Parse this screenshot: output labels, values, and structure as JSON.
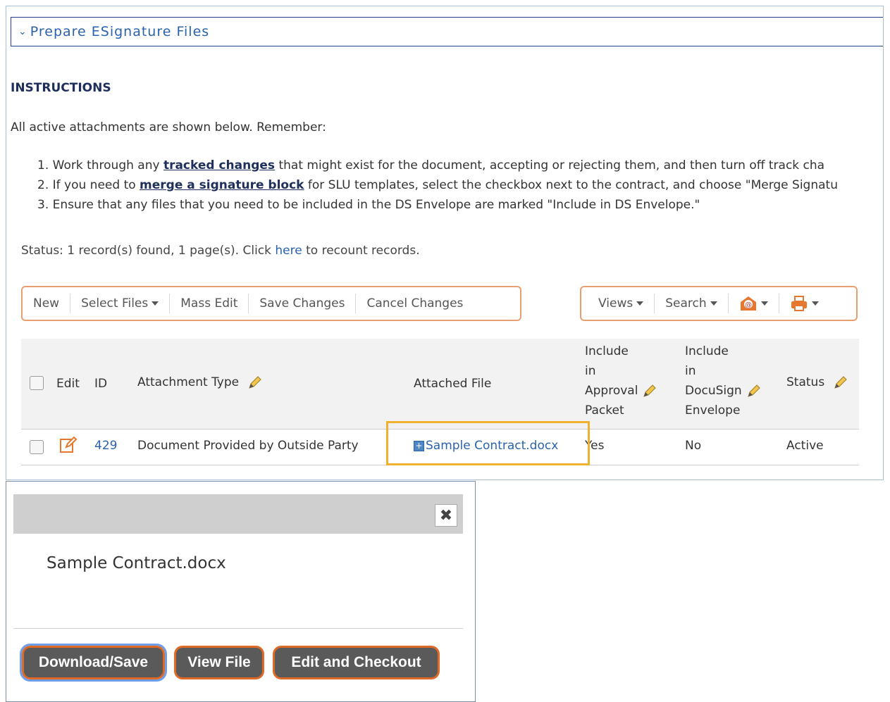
{
  "section": {
    "title": "Prepare ESignature Files"
  },
  "instructions": {
    "title": "INSTRUCTIONS",
    "intro": "All active attachments are shown below. Remember:",
    "steps": [
      {
        "num": "1.",
        "before": "Work through any ",
        "link": "tracked changes",
        "after": " that might exist for the document, accepting or rejecting them, and then turn off track cha"
      },
      {
        "num": "2.",
        "before": "If you need to ",
        "link": "merge a signature block",
        "after": " for SLU templates, select the checkbox next to the contract, and choose \"Merge Signatu"
      },
      {
        "num": "3.",
        "before": "Ensure that any files that you need to be included in the DS Envelope are marked \"Include in DS Envelope.\"",
        "link": "",
        "after": ""
      }
    ]
  },
  "status": {
    "before": "Status: 1 record(s) found, 1 page(s). Click ",
    "link": "here",
    "after": " to recount records."
  },
  "toolbar_left": {
    "new": "New",
    "select_files": "Select Files",
    "mass_edit": "Mass Edit",
    "save_changes": "Save Changes",
    "cancel_changes": "Cancel Changes"
  },
  "toolbar_right": {
    "views": "Views",
    "search": "Search"
  },
  "grid": {
    "headers": {
      "edit": "Edit",
      "id": "ID",
      "attachment_type": "Attachment Type",
      "attached_file": "Attached File",
      "include_approval": [
        "Include",
        "in",
        "Approval",
        "Packet"
      ],
      "include_docusign": [
        "Include",
        "in",
        "DocuSign",
        "Envelope"
      ],
      "status": "Status"
    },
    "rows": [
      {
        "id": "429",
        "attachment_type": "Document Provided by Outside Party",
        "attached_file": "Sample Contract.docx",
        "include_approval": "Yes",
        "include_docusign": "No",
        "status": "Active"
      }
    ]
  },
  "popup": {
    "file_name": "Sample Contract.docx",
    "buttons": {
      "download": "Download/Save",
      "view": "View File",
      "edit_checkout": "Edit and Checkout"
    }
  },
  "colors": {
    "accent_blue": "#2a63ac",
    "toolbar_border": "#e8a070",
    "highlight": "#f0b030",
    "button_border": "#e06a25"
  }
}
